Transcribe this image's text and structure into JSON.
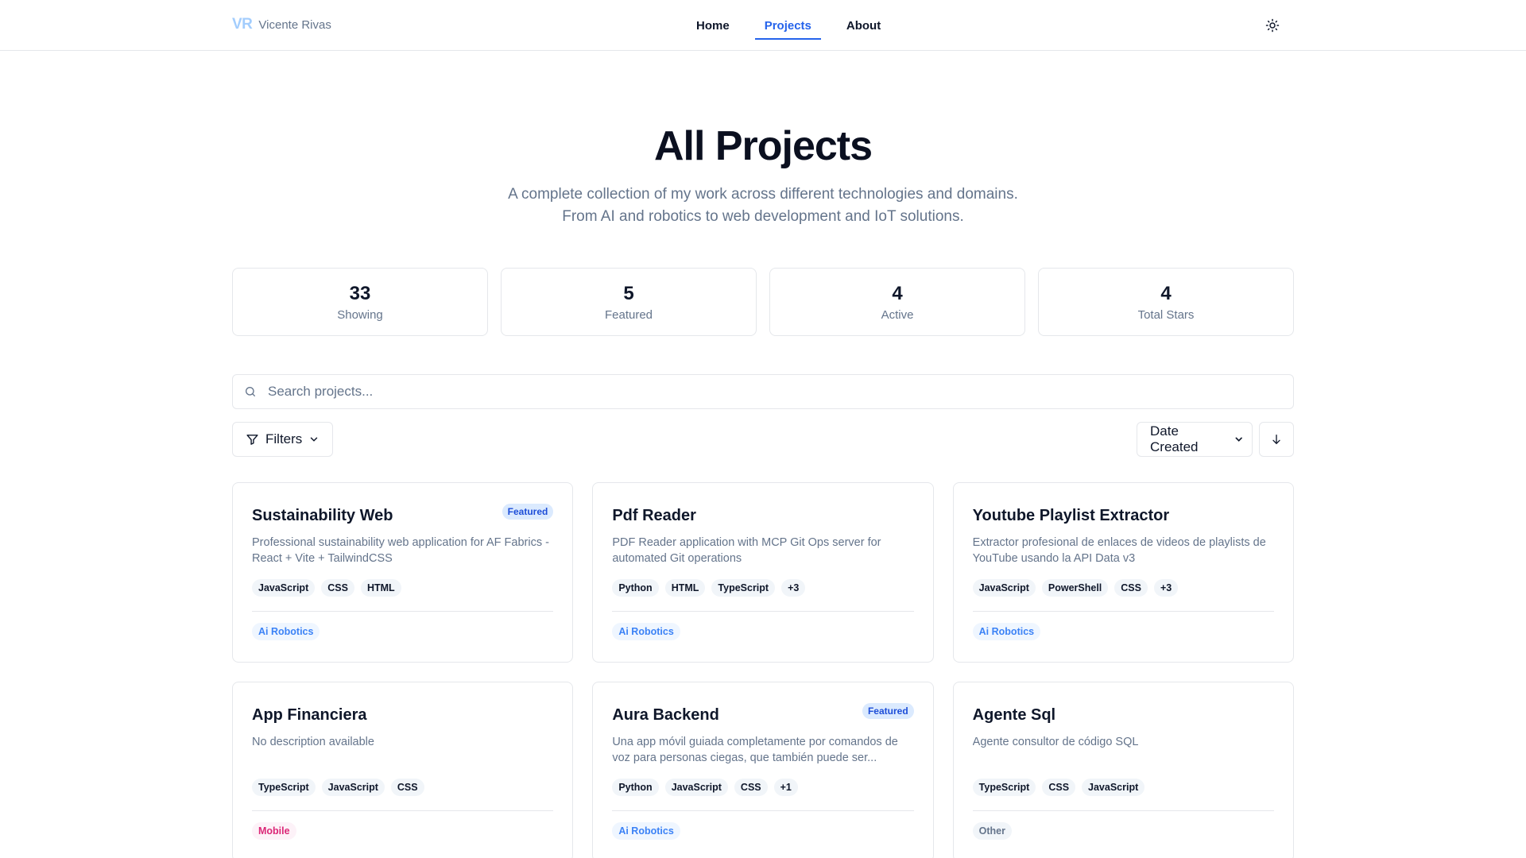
{
  "header": {
    "logo": "VR",
    "brand_name": "Vicente Rivas",
    "nav": [
      {
        "label": "Home",
        "active": false
      },
      {
        "label": "Projects",
        "active": true
      },
      {
        "label": "About",
        "active": false
      }
    ],
    "theme_icon": "sun-icon"
  },
  "hero": {
    "title": "All Projects",
    "subtitle_line1": "A complete collection of my work across different technologies and domains.",
    "subtitle_line2": "From AI and robotics to web development and IoT solutions."
  },
  "stats": [
    {
      "value": "33",
      "label": "Showing"
    },
    {
      "value": "5",
      "label": "Featured"
    },
    {
      "value": "4",
      "label": "Active"
    },
    {
      "value": "4",
      "label": "Total Stars"
    }
  ],
  "search": {
    "placeholder": "Search projects...",
    "value": ""
  },
  "controls": {
    "filters_label": "Filters",
    "sort_selected": "Date Created",
    "sort_icon": "arrow-down-icon"
  },
  "projects": [
    {
      "title": "Sustainability Web",
      "featured": true,
      "description": "Professional sustainability web application for AF Fabrics - React + Vite + TailwindCSS",
      "tags": [
        "JavaScript",
        "CSS",
        "HTML"
      ],
      "category": "Ai Robotics",
      "category_style": "blue"
    },
    {
      "title": "Pdf Reader",
      "featured": false,
      "description": "PDF Reader application with MCP Git Ops server for automated Git operations",
      "tags": [
        "Python",
        "HTML",
        "TypeScript",
        "+3"
      ],
      "category": "Ai Robotics",
      "category_style": "blue"
    },
    {
      "title": "Youtube Playlist Extractor",
      "featured": false,
      "description": "Extractor profesional de enlaces de videos de playlists de YouTube usando la API Data v3",
      "tags": [
        "JavaScript",
        "PowerShell",
        "CSS",
        "+3"
      ],
      "category": "Ai Robotics",
      "category_style": "blue"
    },
    {
      "title": "App Financiera",
      "featured": false,
      "description": "No description available",
      "tags": [
        "TypeScript",
        "JavaScript",
        "CSS"
      ],
      "category": "Mobile",
      "category_style": "pink"
    },
    {
      "title": "Aura Backend",
      "featured": true,
      "description": "Una app móvil guiada completamente por comandos de voz para personas ciegas, que también puede ser...",
      "tags": [
        "Python",
        "JavaScript",
        "CSS",
        "+1"
      ],
      "category": "Ai Robotics",
      "category_style": "blue"
    },
    {
      "title": "Agente Sql",
      "featured": false,
      "description": "Agente consultor de código SQL",
      "tags": [
        "TypeScript",
        "CSS",
        "JavaScript"
      ],
      "category": "Other",
      "category_style": "gray"
    }
  ],
  "featured_label": "Featured",
  "colors": {
    "accent": "#2563eb",
    "muted": "#64748b",
    "border": "#e5e7eb"
  }
}
